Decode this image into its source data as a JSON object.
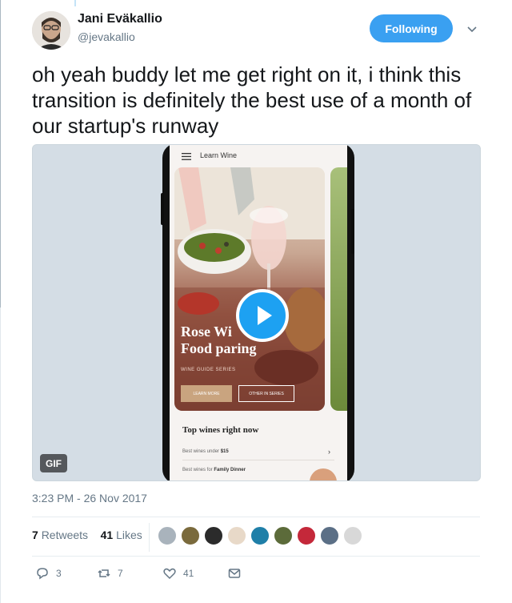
{
  "author": {
    "name": "Jani Eväkallio",
    "handle": "@jevakallio"
  },
  "follow_button": {
    "label": "Following"
  },
  "tweet": {
    "text": "oh yeah buddy let me get right on it, i think this transition is definitely the best use of a month of our startup's runway"
  },
  "media": {
    "badge": "GIF",
    "app": {
      "title": "Learn Wine",
      "card_title_line1": "Rose Wi",
      "card_title_line2": "Food paring",
      "card_subtitle": "WINE GUIDE SERIES",
      "learn_more": "LEARN MORE",
      "other_series": "OTHER IN SERIES",
      "section_title": "Top wines right now",
      "rows": [
        {
          "prefix": "Best wines under ",
          "bold": "$15"
        },
        {
          "prefix": "Best wines for ",
          "bold": "Family Dinner"
        }
      ]
    }
  },
  "timestamp": "3:23 PM - 26 Nov 2017",
  "stats": {
    "retweets_count": "7",
    "retweets_label": "Retweets",
    "likes_count": "41",
    "likes_label": "Likes"
  },
  "likers": [
    {
      "color": "#a9b3bc"
    },
    {
      "color": "#7a6a3c"
    },
    {
      "color": "#2b2b2b"
    },
    {
      "color": "#e8d9c8"
    },
    {
      "color": "#1f7fa8"
    },
    {
      "color": "#5c6b3a"
    },
    {
      "color": "#c4283a"
    },
    {
      "color": "#5b6f86"
    },
    {
      "color": "#d8d8d8"
    }
  ],
  "actions": {
    "reply_count": "3",
    "retweet_count": "7",
    "like_count": "41"
  },
  "colors": {
    "accent": "#1da1f2",
    "text_secondary": "#657786"
  }
}
